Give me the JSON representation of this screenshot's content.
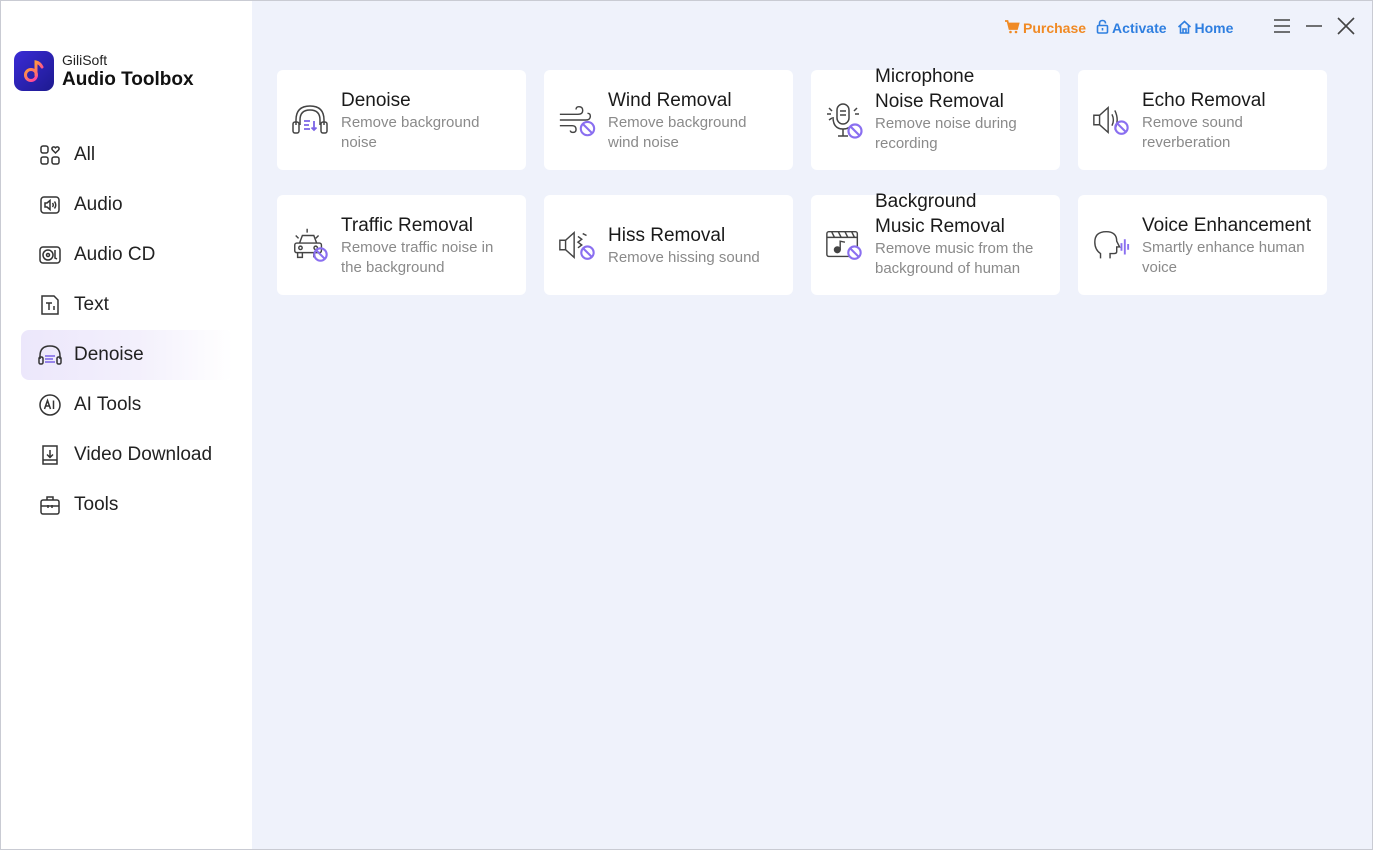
{
  "brand": {
    "company": "GiliSoft",
    "product": "Audio Toolbox",
    "accent": "#2b23b8"
  },
  "sidebar": {
    "items": [
      {
        "label": "All",
        "icon": "grid-heart-icon",
        "active": false
      },
      {
        "label": "Audio",
        "icon": "speaker-box-icon",
        "active": false
      },
      {
        "label": "Audio CD",
        "icon": "disc-icon",
        "active": false
      },
      {
        "label": "Text",
        "icon": "text-doc-icon",
        "active": false
      },
      {
        "label": "Denoise",
        "icon": "headphone-wave-icon",
        "active": true
      },
      {
        "label": "AI Tools",
        "icon": "ai-circle-icon",
        "active": false
      },
      {
        "label": "Video Download",
        "icon": "download-tray-icon",
        "active": false
      },
      {
        "label": "Tools",
        "icon": "toolbox-icon",
        "active": false
      }
    ]
  },
  "topbar": {
    "purchase": "Purchase",
    "activate": "Activate",
    "home": "Home",
    "purchase_color": "#f08a24",
    "link_color": "#2f7fe0"
  },
  "cards": [
    {
      "title": "Denoise",
      "desc1": "Remove background",
      "desc2": "noise",
      "icon": "headphone-denoise-icon"
    },
    {
      "title": "Wind Removal",
      "desc1": "Remove background",
      "desc2": "wind noise",
      "icon": "wind-ban-icon"
    },
    {
      "title": "Microphone\nNoise Removal",
      "desc1": "Remove noise during",
      "desc2": "recording",
      "icon": "microphone-ban-icon"
    },
    {
      "title": "Echo Removal",
      "desc1": "Remove sound",
      "desc2": "reverberation",
      "icon": "speaker-ban-icon"
    },
    {
      "title": "Traffic Removal",
      "desc1": "Remove traffic noise in",
      "desc2": "the background",
      "icon": "car-ban-icon"
    },
    {
      "title": "Hiss Removal",
      "desc1": "Remove hissing sound",
      "desc2": "",
      "icon": "hiss-ban-icon"
    },
    {
      "title": "Background\nMusic Removal",
      "desc1": "Remove music from the",
      "desc2": "background of human",
      "icon": "music-ban-icon"
    },
    {
      "title": "Voice Enhancement",
      "desc1": "Smartly enhance human",
      "desc2": "voice",
      "icon": "voice-head-icon"
    }
  ]
}
